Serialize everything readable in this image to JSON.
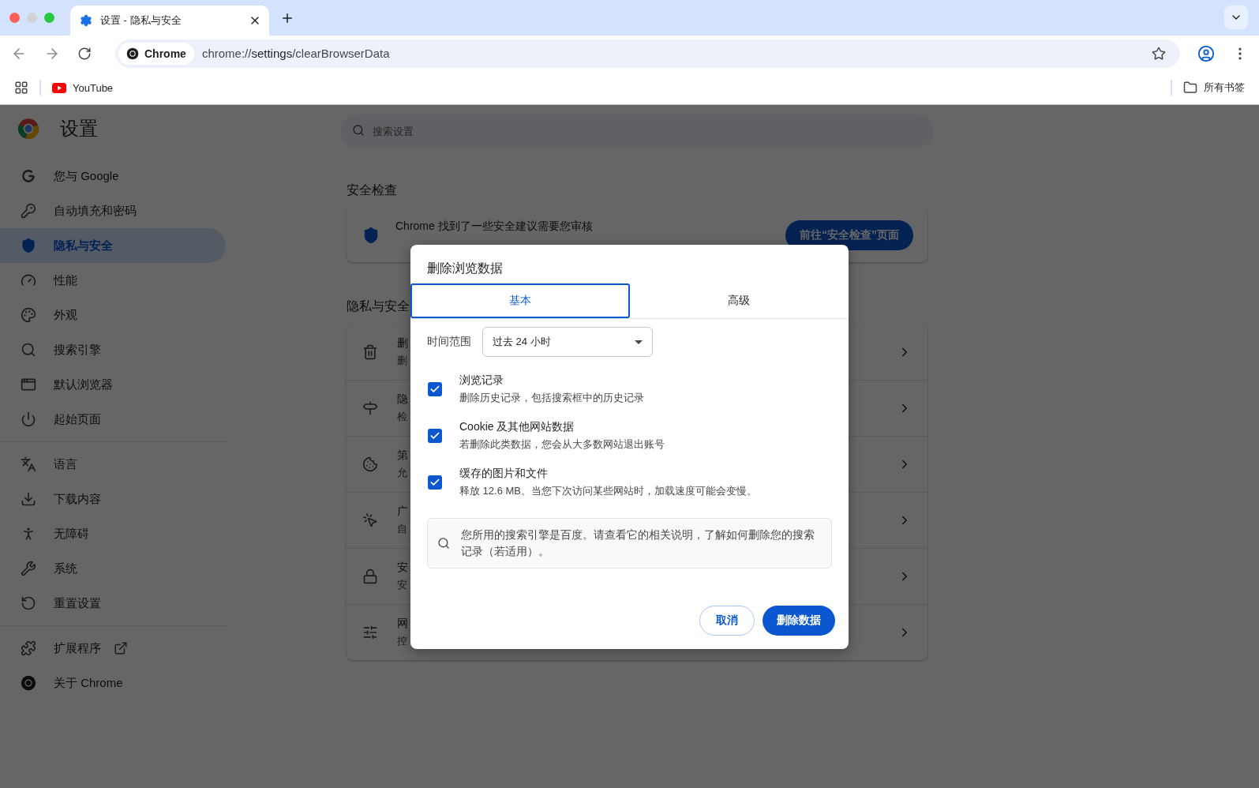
{
  "browser": {
    "tabs": [
      {
        "title": "设置 - 隐私与安全",
        "selected": true
      }
    ],
    "toolbar": {
      "chip": "Chrome",
      "url": "chrome://**settings**/clearBrowserData"
    },
    "bookmarks": [
      {
        "label": "YouTube"
      }
    ],
    "all_bookmarks": "所有书签"
  },
  "sidebar": {
    "title": "设置",
    "groups": [
      {
        "items": [
          {
            "label": "您与 Google",
            "selected": false
          },
          {
            "label": "自动填充和密码",
            "selected": false
          },
          {
            "label": "隐私与安全",
            "selected": true
          },
          {
            "label": "性能",
            "selected": false
          },
          {
            "label": "外观",
            "selected": false
          },
          {
            "label": "搜索引擎",
            "selected": false
          },
          {
            "label": "默认浏览器",
            "selected": false
          },
          {
            "label": "起始页面",
            "selected": false
          }
        ]
      },
      {
        "items": [
          {
            "label": "语言",
            "selected": false
          },
          {
            "label": "下载内容",
            "selected": false
          },
          {
            "label": "无障碍",
            "selected": false
          },
          {
            "label": "系统",
            "selected": false
          },
          {
            "label": "重置设置",
            "selected": false
          }
        ]
      },
      {
        "items": [
          {
            "label": "扩展程序",
            "selected": false,
            "external": true
          },
          {
            "label": "关于 Chrome",
            "selected": false
          }
        ]
      }
    ]
  },
  "main": {
    "search": {
      "placeholder": "搜索设置"
    },
    "safety_check": {
      "heading": "安全检查",
      "message": "Chrome 找到了一些安全建议需要您审核",
      "button": "前往“安全检查”页面"
    },
    "privacy": {
      "heading": "隐私与安全",
      "rows": [
        {
          "title": "删",
          "subtitle": "删"
        },
        {
          "title": "隐",
          "subtitle": "检"
        },
        {
          "title": "第",
          "subtitle": "允"
        },
        {
          "title": "广",
          "subtitle": "自"
        },
        {
          "title": "安",
          "subtitle": "安"
        },
        {
          "title": "网",
          "subtitle": "控"
        }
      ]
    }
  },
  "dialog": {
    "title": "删除浏览数据",
    "tabs": [
      {
        "label": "基本",
        "selected": true
      },
      {
        "label": "高级",
        "selected": false
      }
    ],
    "time_range": {
      "label": "时间范围",
      "value": "过去 24 小时"
    },
    "options": [
      {
        "title": "浏览记录",
        "description": "删除历史记录，包括搜索框中的历史记录",
        "checked": true
      },
      {
        "title": "Cookie 及其他网站数据",
        "description": "若删除此类数据，您会从大多数网站退出账号",
        "checked": true
      },
      {
        "title": "缓存的图片和文件",
        "description": "释放 12.6 MB。当您下次访问某些网站时，加载速度可能会变慢。",
        "checked": true
      }
    ],
    "notice": "您所用的搜索引擎是百度。请查看它的相关说明，了解如何删除您的搜索记录（若适用）。",
    "buttons": {
      "cancel": "取消",
      "confirm": "删除数据"
    }
  }
}
